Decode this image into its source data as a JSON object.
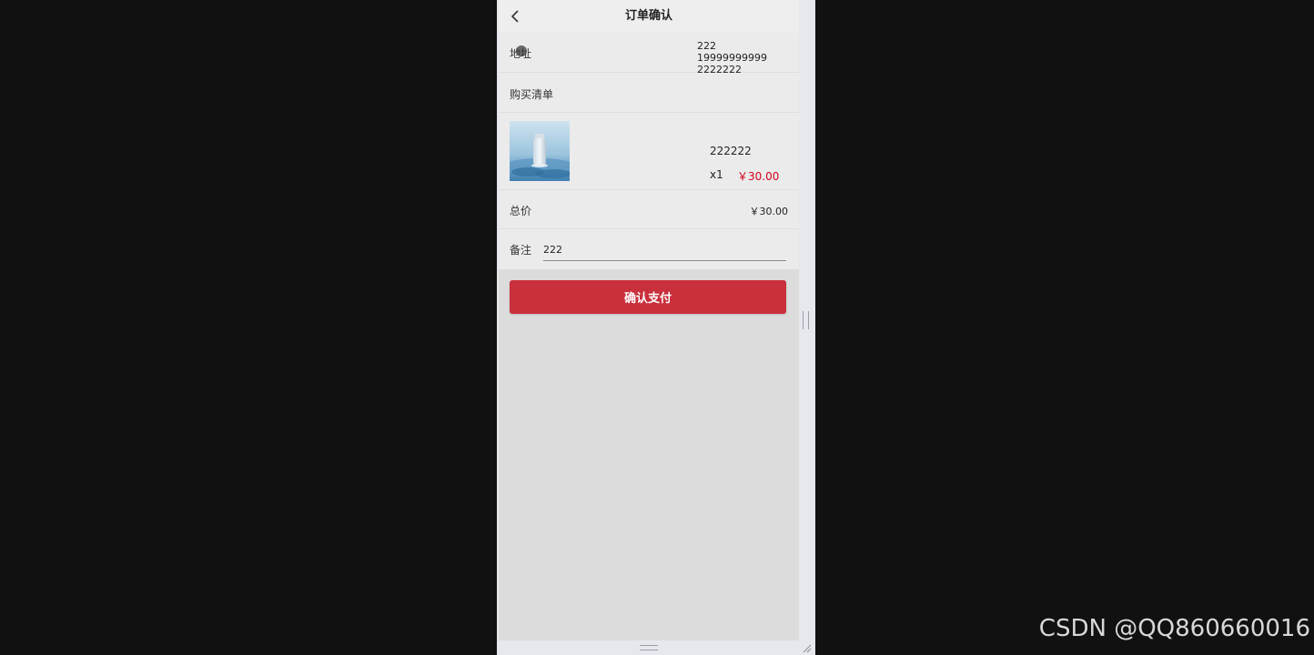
{
  "nav": {
    "title": "订单确认",
    "back_icon": "chevron-left-icon"
  },
  "address": {
    "label": "地址",
    "line1": "222 19999999999",
    "line2": "2222222"
  },
  "purchase_list": {
    "label": "购买清单"
  },
  "item": {
    "name": "222222",
    "quantity": "x1",
    "price": "￥30.00",
    "price_color": "#d0021b"
  },
  "total": {
    "label": "总价",
    "value": "￥30.00"
  },
  "note": {
    "label": "备注",
    "value": "222"
  },
  "pay_button": {
    "label": "确认支付",
    "color": "#c9303c"
  },
  "watermark": "CSDN @QQ860660016"
}
